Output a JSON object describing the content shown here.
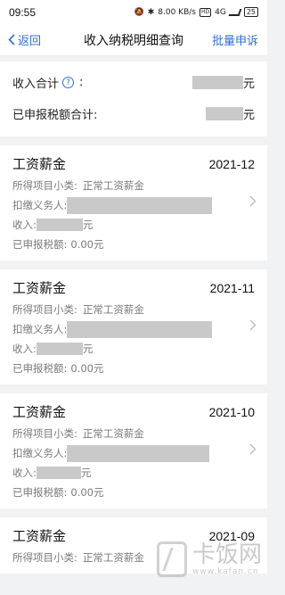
{
  "status_bar": {
    "time": "09:55",
    "net_speed": "8.00 KB/s",
    "hd_label": "HD",
    "net_type": "4G",
    "battery": "25"
  },
  "nav": {
    "back_label": "返回",
    "title": "收入纳税明细查询",
    "action_label": "批量申诉"
  },
  "summary": {
    "income_total_label": "收入合计",
    "colon": ":",
    "income_unit": "元",
    "tax_total_label": "已申报税额合计:",
    "tax_unit": "元"
  },
  "records": [
    {
      "title": "工资薪金",
      "date": "2021-12",
      "subcategory_label": "所得项目小类:",
      "subcategory_value": "正常工资薪金",
      "withholder_label": "扣缴义务人:",
      "income_label": "收入:",
      "income_unit": "元",
      "tax_label": "已申报税额:",
      "tax_value": "0.00元"
    },
    {
      "title": "工资薪金",
      "date": "2021-11",
      "subcategory_label": "所得项目小类:",
      "subcategory_value": "正常工资薪金",
      "withholder_label": "扣缴义务人:",
      "income_label": "收入:",
      "income_unit": "元",
      "tax_label": "已申报税额:",
      "tax_value": "0.00元"
    },
    {
      "title": "工资薪金",
      "date": "2021-10",
      "subcategory_label": "所得项目小类:",
      "subcategory_value": "正常工资薪金",
      "withholder_label": "扣缴义务人:",
      "income_label": "收入:",
      "income_unit": "元",
      "tax_label": "已申报税额:",
      "tax_value": "0.00元"
    },
    {
      "title": "工资薪金",
      "date": "2021-09",
      "subcategory_label": "所得项目小类:",
      "subcategory_value": "正常工资薪金"
    }
  ],
  "watermark": {
    "name": "卡饭网",
    "url": "www.kafan.cn"
  },
  "colors": {
    "accent": "#2f6fd6",
    "mask": "#c9c9c9",
    "background": "#f1f2f4"
  }
}
